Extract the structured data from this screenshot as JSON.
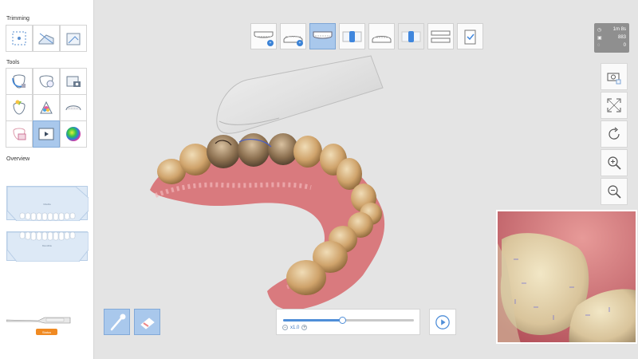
{
  "sidebar": {
    "trimming_title": "Trimming",
    "tools_title": "Tools",
    "overview_title": "Overview",
    "overview_upper_label": "Maxilla",
    "overview_lower_label": "Mandible",
    "trimming_tools": [
      "select-area-icon",
      "trim-region-icon",
      "trim-plane-icon"
    ],
    "tools": [
      "tooth-lock-icon",
      "fill-hole-icon",
      "camera-capture-icon",
      "color-shade-icon",
      "color-palette-icon",
      "arch-view-icon",
      "tooth-highlight-icon",
      "play-video-icon",
      "heatmap-icon"
    ],
    "scanner_status": "Status"
  },
  "stages": [
    {
      "icon": "maxilla-scan-icon",
      "badge": "+"
    },
    {
      "icon": "mandible-scan-icon",
      "badge": "+"
    },
    {
      "icon": "maxilla-view-icon"
    },
    {
      "icon": "bite-right-icon"
    },
    {
      "icon": "mandible-view-icon"
    },
    {
      "icon": "bite-left-icon"
    },
    {
      "icon": "full-arch-icon"
    },
    {
      "icon": "checklist-icon"
    }
  ],
  "info": {
    "time": "1m 8s",
    "shots": "883",
    "count": "0"
  },
  "right_tools": [
    "camera-settings-icon",
    "fit-screen-icon",
    "reset-view-icon",
    "zoom-in-icon",
    "zoom-out-icon"
  ],
  "playback": {
    "speed": "x1.0",
    "progress": 0.45
  },
  "colors": {
    "accent": "#4f8ed8",
    "active_tool": "#a9c8ec",
    "status_orange": "#f08a22"
  }
}
